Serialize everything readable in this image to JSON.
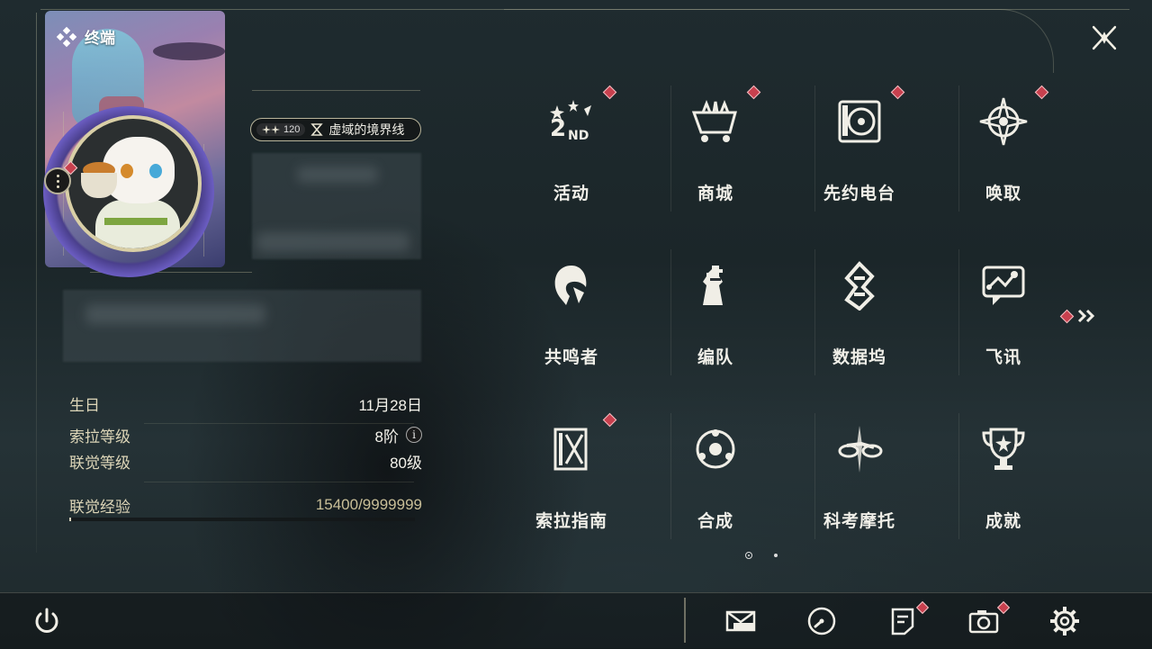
{
  "header": {
    "card_label": "终端",
    "close_icon": "close-x-icon"
  },
  "profile": {
    "title_badge": {
      "level": "120",
      "name": "虚域的境界线"
    },
    "stats": [
      {
        "label": "生日",
        "value": "11月28日"
      },
      {
        "label": "索拉等级",
        "value": "8阶"
      },
      {
        "label": "联觉等级",
        "value": "80级"
      },
      {
        "label": "联觉经验",
        "value": "15400/9999999"
      }
    ],
    "exp_progress": 0.0015
  },
  "menu": {
    "items": [
      {
        "label": "活动",
        "icon": "event-2nd-icon",
        "badge": true
      },
      {
        "label": "商城",
        "icon": "shop-cart-icon",
        "badge": true
      },
      {
        "label": "先约电台",
        "icon": "radio-icon",
        "badge": true
      },
      {
        "label": "唤取",
        "icon": "convene-icon",
        "badge": true
      },
      {
        "label": "共鸣者",
        "icon": "resonator-icon",
        "badge": false
      },
      {
        "label": "编队",
        "icon": "team-chess-icon",
        "badge": false
      },
      {
        "label": "数据坞",
        "icon": "data-dock-icon",
        "badge": false
      },
      {
        "label": "飞讯",
        "icon": "chat-icon",
        "badge": false
      },
      {
        "label": "索拉指南",
        "icon": "guidebook-icon",
        "badge": true
      },
      {
        "label": "合成",
        "icon": "synthesis-icon",
        "badge": false
      },
      {
        "label": "科考摩托",
        "icon": "motorcycle-icon",
        "badge": false
      },
      {
        "label": "成就",
        "icon": "trophy-icon",
        "badge": false
      }
    ],
    "page_current": 1,
    "page_total": 2
  },
  "bottom_bar": {
    "icons": [
      "power-icon",
      "mail-icon",
      "clock-icon",
      "notice-icon",
      "camera-icon",
      "settings-gear-icon"
    ]
  },
  "colors": {
    "accent_red": "#c8404e",
    "gold": "#d9cfa6",
    "text_light": "#f0efe8"
  }
}
